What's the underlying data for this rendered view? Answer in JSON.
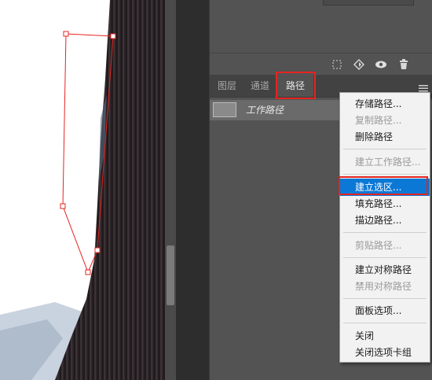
{
  "layers_toolbar": {
    "icons": [
      "selection-icon",
      "fill-adjust-icon",
      "eye-icon",
      "trash-icon"
    ]
  },
  "tabs": [
    {
      "label": "图层"
    },
    {
      "label": "通道"
    },
    {
      "label": "路径",
      "active": true
    }
  ],
  "paths": [
    {
      "label": "工作路径"
    }
  ],
  "context_menu": {
    "items": [
      {
        "label": "存储路径...",
        "enabled": true
      },
      {
        "label": "复制路径...",
        "enabled": false
      },
      {
        "label": "删除路径",
        "enabled": true
      },
      {
        "label": "建立工作路径...",
        "enabled": false
      },
      {
        "label": "建立选区...",
        "enabled": true,
        "selected": true
      },
      {
        "label": "填充路径...",
        "enabled": true
      },
      {
        "label": "描边路径...",
        "enabled": true
      },
      {
        "label": "剪贴路径...",
        "enabled": false
      },
      {
        "label": "建立对称路径",
        "enabled": true
      },
      {
        "label": "禁用对称路径",
        "enabled": false
      },
      {
        "label": "面板选项...",
        "enabled": true
      },
      {
        "label": "关闭",
        "enabled": true
      },
      {
        "label": "关闭选项卡组",
        "enabled": true
      }
    ]
  },
  "colors": {
    "highlight_red": "#e52420",
    "menu_selection_blue": "#0b78d6",
    "panel_bg": "#535353"
  }
}
